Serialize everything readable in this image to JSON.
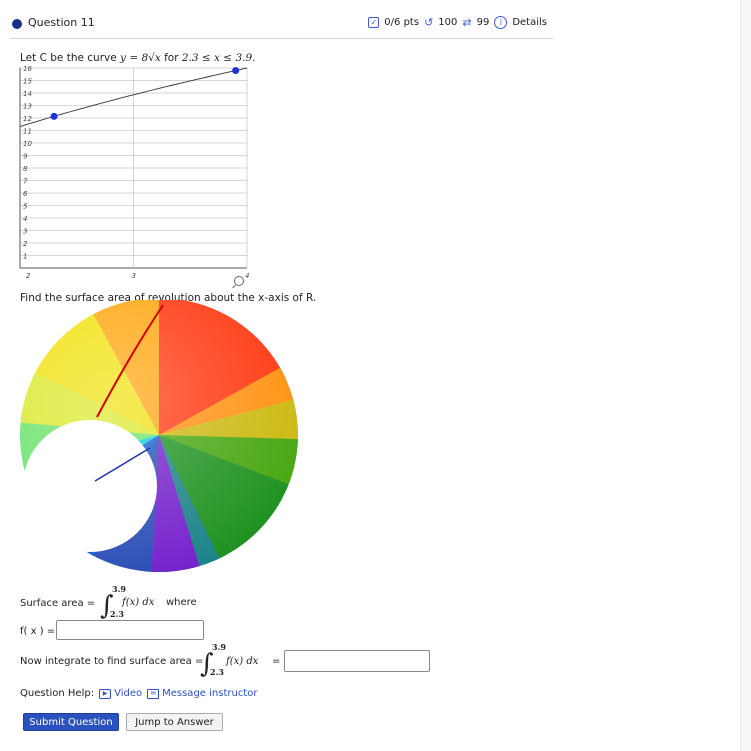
{
  "header": {
    "question_title": "Question 11",
    "points": "0/6 pts",
    "retries": "100",
    "submissions": "99",
    "details": "Details"
  },
  "prompt": {
    "text_before": "Let C be the curve ",
    "equation": "y = 8√x",
    "text_mid": " for ",
    "domain": "2.3 ≤ x ≤ 3.9."
  },
  "chart_data": {
    "type": "line",
    "x": [
      2.3,
      3.9
    ],
    "series": [
      {
        "values": [
          12.13,
          15.8
        ]
      }
    ],
    "x_range": [
      2,
      4
    ],
    "y_range": [
      0,
      16
    ],
    "x_tick_labels": [
      "2",
      "3",
      "4"
    ],
    "y_tick_labels": [
      "1",
      "2",
      "3",
      "4",
      "5",
      "6",
      "7",
      "8",
      "9",
      "10",
      "11",
      "12",
      "13",
      "14",
      "15",
      "16"
    ],
    "endpoints": [
      {
        "x": 2.3,
        "y": 12.13
      },
      {
        "x": 3.9,
        "y": 15.8
      }
    ],
    "grid": true
  },
  "find_text": "Find the surface area of revolution about the x-axis of R.",
  "surface_label": "Surface area =",
  "integral": {
    "upper": "3.9",
    "lower": "2.3",
    "body": "f(x) dx",
    "where": "where"
  },
  "fx_label": "f( x ) =",
  "now_label": "Now integrate to find surface area =",
  "equals": "=",
  "help": {
    "label": "Question Help:",
    "video": "Video",
    "message": "Message instructor"
  },
  "buttons": {
    "submit": "Submit Question",
    "jump": "Jump to Answer"
  },
  "colors": {
    "accent": "#2a52be",
    "point": "#1a33d6",
    "curve": "#cc0000",
    "radius_line": "#2233aa"
  }
}
